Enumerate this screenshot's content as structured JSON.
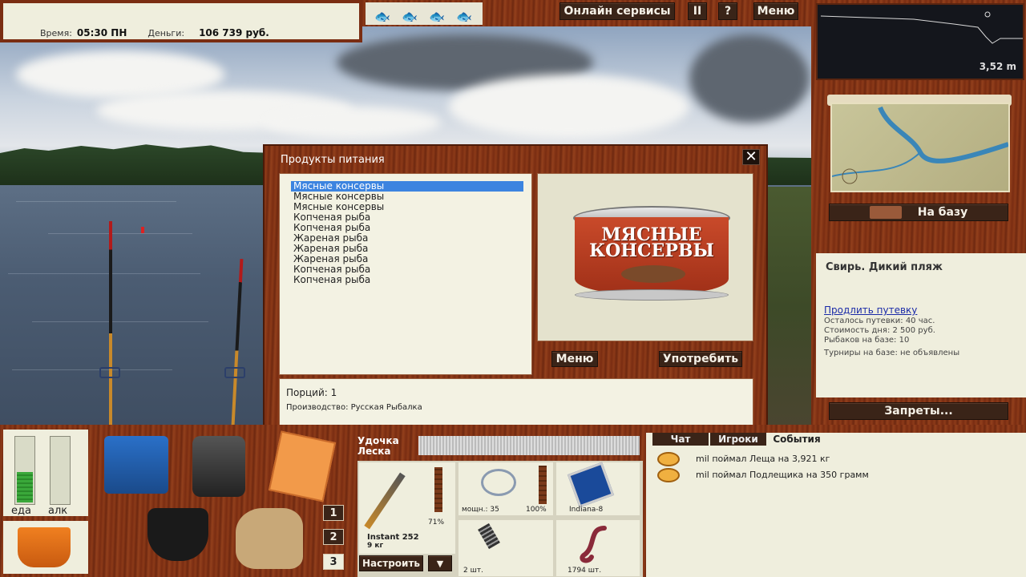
{
  "status": {
    "time_label": "Время:",
    "time_value": "05:30 ПН",
    "money_label": "Деньги:",
    "money_value": "106 739 руб."
  },
  "topbar": {
    "online_services": "Онлайн сервисы",
    "pause": "II",
    "help": "?",
    "menu": "Меню"
  },
  "depth": {
    "value": "3,52 m"
  },
  "map": {
    "go_base": "На базу"
  },
  "location": {
    "name": "Свирь. Дикий пляж",
    "extend_link": "Продлить путевку",
    "remaining": "Осталось путевки: 40 час.",
    "day_cost": "Стоимость дня: 2 500 руб.",
    "anglers": "Рыбаков на базе: 10",
    "tournaments": "Турниры на базе: не объявлены",
    "bans_button": "Запреты..."
  },
  "dialog": {
    "title": "Продукты питания",
    "close": "✕",
    "items": [
      {
        "label": "Мясные консервы",
        "selected": true
      },
      {
        "label": "Мясные консервы",
        "selected": false
      },
      {
        "label": "Мясные консервы",
        "selected": false
      },
      {
        "label": "Копченая рыба",
        "selected": false
      },
      {
        "label": "Копченая рыба",
        "selected": false
      },
      {
        "label": "Жареная рыба",
        "selected": false
      },
      {
        "label": "Жареная рыба",
        "selected": false
      },
      {
        "label": "Жареная рыба",
        "selected": false
      },
      {
        "label": "Копченая рыба",
        "selected": false
      },
      {
        "label": "Копченая рыба",
        "selected": false
      }
    ],
    "can_label_line1": "МЯСНЫЕ",
    "can_label_line2": "КОНСЕРВЫ",
    "menu_button": "Меню",
    "use_button": "Употребить",
    "portions": "Порций: 1",
    "producer": "Производство: Русская Рыбалка"
  },
  "meters": {
    "food_label": "еда",
    "alc_label": "алк",
    "food_level": 0.45,
    "alc_level": 0
  },
  "slots": {
    "n1": "1",
    "n2": "2",
    "n3": "3"
  },
  "tackle": {
    "rod_tab": "Удочка",
    "line_tab": "Леска",
    "rod_name": "Instant 252",
    "rod_weight": "9 кг",
    "rod_pct": "71%",
    "reel_power": "мощн.: 35",
    "reel_pct": "100%",
    "line_name": "Indiana-8",
    "feeder_count": "2 шт.",
    "bait_count": "1794 шт.",
    "setup_button": "Настроить",
    "dropdown": "▼"
  },
  "events": {
    "tabs": [
      "Чат",
      "Игроки",
      "События"
    ],
    "lines": [
      "mil поймал Леща на 3,921 кг",
      "mil поймал Подлещика на 350 грамм"
    ]
  }
}
